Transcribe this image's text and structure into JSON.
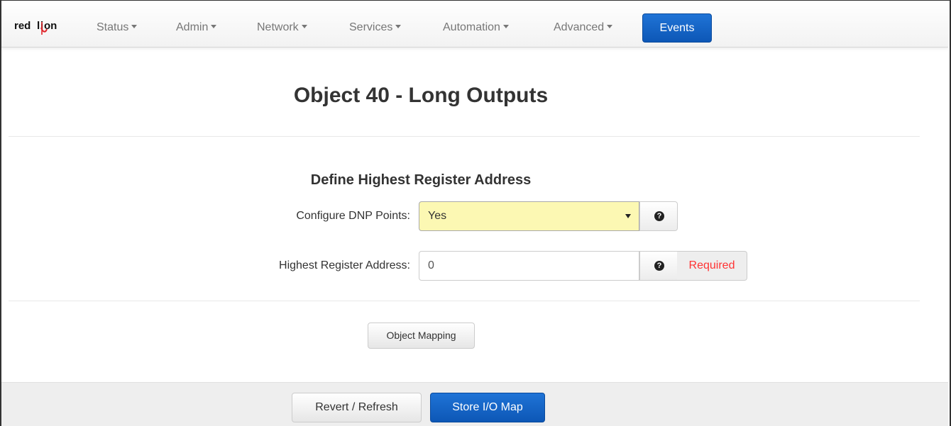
{
  "brand": {
    "logo_text": "red lion",
    "accent_color": "#e0262b"
  },
  "navbar": {
    "items": [
      {
        "label": "Status"
      },
      {
        "label": "Admin"
      },
      {
        "label": "Network"
      },
      {
        "label": "Services"
      },
      {
        "label": "Automation"
      },
      {
        "label": "Advanced"
      }
    ],
    "active_item": {
      "label": "Events"
    },
    "active_color": "#0d57b6"
  },
  "page": {
    "title": "Object 40 - Long Outputs"
  },
  "form": {
    "section_title": "Define Highest Register Address",
    "configure_dnp": {
      "label": "Configure DNP Points:",
      "selected_value": "Yes",
      "highlight_color": "#fcf8b3",
      "help_icon": "question-circle-icon"
    },
    "highest_register": {
      "label": "Highest Register Address:",
      "value": "0",
      "help_icon": "question-circle-icon",
      "status_text": "Required",
      "status_color": "#ff3333"
    },
    "object_mapping_label": "Object Mapping"
  },
  "footer": {
    "revert_label": "Revert / Refresh",
    "store_label": "Store I/O Map"
  }
}
